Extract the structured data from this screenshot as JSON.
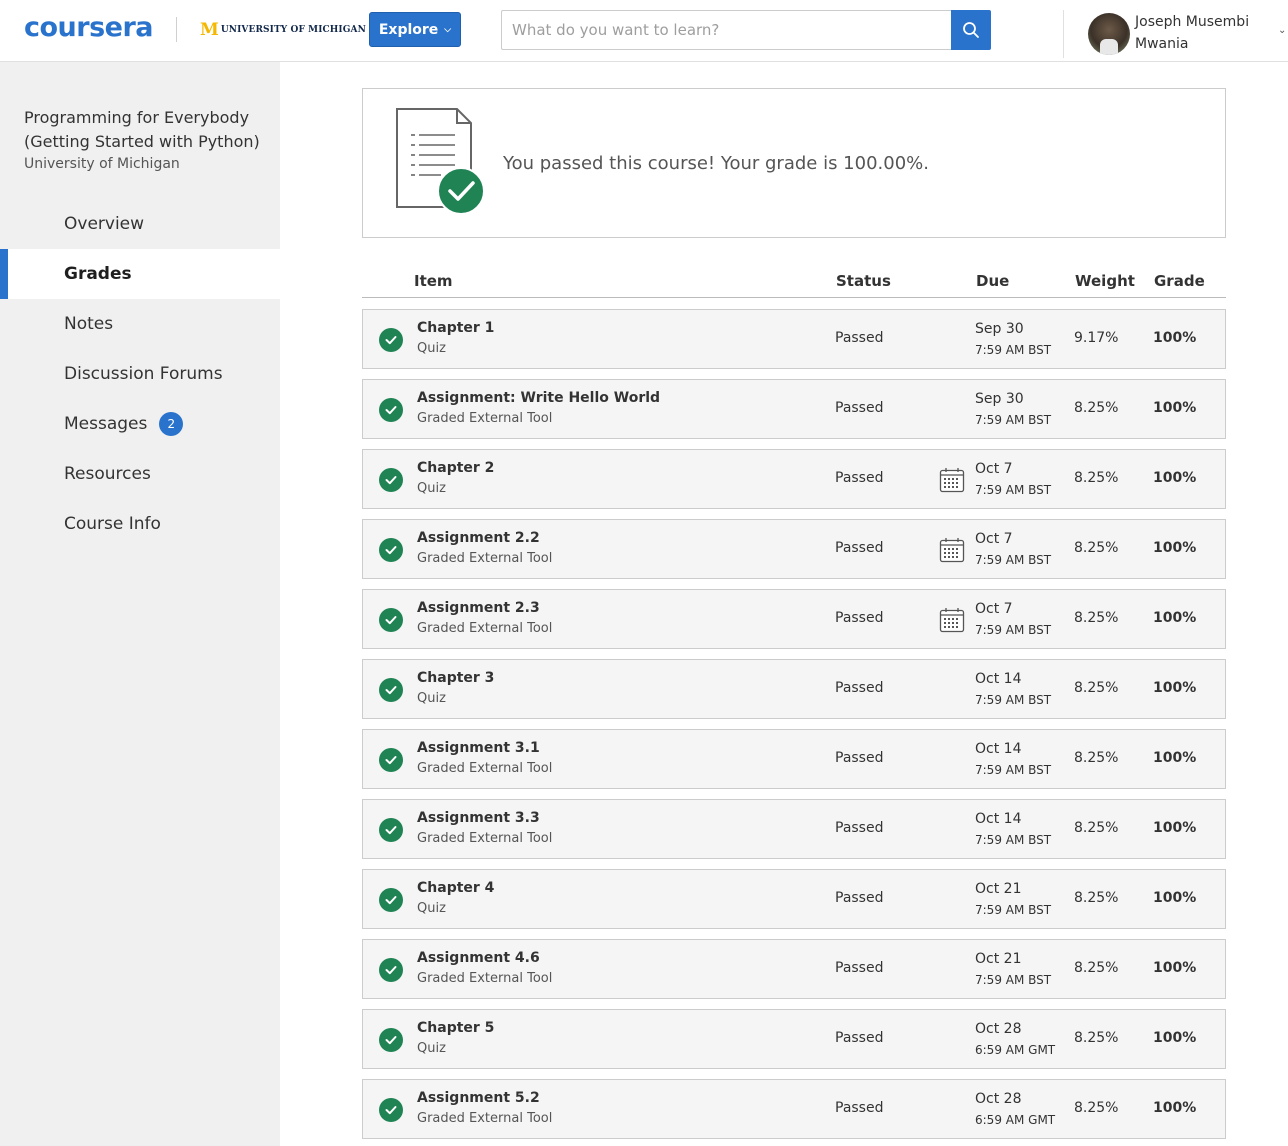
{
  "header": {
    "logo": "coursera",
    "partner_initial": "M",
    "partner_name": "UNIVERSITY OF MICHIGAN",
    "explore_label": "Explore",
    "search_placeholder": "What do you want to learn?",
    "user_name_line1": "Joseph Musembi",
    "user_name_line2": "Mwania"
  },
  "sidebar": {
    "course_title": "Programming for Everybody (Getting Started with Python)",
    "course_org": "University of Michigan",
    "items": [
      {
        "label": "Overview"
      },
      {
        "label": "Grades",
        "active": true
      },
      {
        "label": "Notes"
      },
      {
        "label": "Discussion Forums"
      },
      {
        "label": "Messages",
        "badge": "2"
      },
      {
        "label": "Resources"
      },
      {
        "label": "Course Info"
      }
    ]
  },
  "banner": {
    "text": "You passed this course! Your grade is 100.00%."
  },
  "table": {
    "headers": {
      "item": "Item",
      "status": "Status",
      "due": "Due",
      "weight": "Weight",
      "grade": "Grade"
    },
    "rows": [
      {
        "name": "Chapter 1",
        "type": "Quiz",
        "status": "Passed",
        "due_date": "Sep 30",
        "due_time": "7:59 AM BST",
        "calendar": false,
        "weight": "9.17%",
        "grade": "100%"
      },
      {
        "name": "Assignment: Write Hello World",
        "type": "Graded External Tool",
        "status": "Passed",
        "due_date": "Sep 30",
        "due_time": "7:59 AM BST",
        "calendar": false,
        "weight": "8.25%",
        "grade": "100%"
      },
      {
        "name": "Chapter 2",
        "type": "Quiz",
        "status": "Passed",
        "due_date": "Oct 7",
        "due_time": "7:59 AM BST",
        "calendar": true,
        "weight": "8.25%",
        "grade": "100%"
      },
      {
        "name": "Assignment 2.2",
        "type": "Graded External Tool",
        "status": "Passed",
        "due_date": "Oct 7",
        "due_time": "7:59 AM BST",
        "calendar": true,
        "weight": "8.25%",
        "grade": "100%"
      },
      {
        "name": "Assignment 2.3",
        "type": "Graded External Tool",
        "status": "Passed",
        "due_date": "Oct 7",
        "due_time": "7:59 AM BST",
        "calendar": true,
        "weight": "8.25%",
        "grade": "100%"
      },
      {
        "name": "Chapter 3",
        "type": "Quiz",
        "status": "Passed",
        "due_date": "Oct 14",
        "due_time": "7:59 AM BST",
        "calendar": false,
        "weight": "8.25%",
        "grade": "100%"
      },
      {
        "name": "Assignment 3.1",
        "type": "Graded External Tool",
        "status": "Passed",
        "due_date": "Oct 14",
        "due_time": "7:59 AM BST",
        "calendar": false,
        "weight": "8.25%",
        "grade": "100%"
      },
      {
        "name": "Assignment 3.3",
        "type": "Graded External Tool",
        "status": "Passed",
        "due_date": "Oct 14",
        "due_time": "7:59 AM BST",
        "calendar": false,
        "weight": "8.25%",
        "grade": "100%"
      },
      {
        "name": "Chapter 4",
        "type": "Quiz",
        "status": "Passed",
        "due_date": "Oct 21",
        "due_time": "7:59 AM BST",
        "calendar": false,
        "weight": "8.25%",
        "grade": "100%"
      },
      {
        "name": "Assignment 4.6",
        "type": "Graded External Tool",
        "status": "Passed",
        "due_date": "Oct 21",
        "due_time": "7:59 AM BST",
        "calendar": false,
        "weight": "8.25%",
        "grade": "100%"
      },
      {
        "name": "Chapter 5",
        "type": "Quiz",
        "status": "Passed",
        "due_date": "Oct 28",
        "due_time": "6:59 AM GMT",
        "calendar": false,
        "weight": "8.25%",
        "grade": "100%"
      },
      {
        "name": "Assignment 5.2",
        "type": "Graded External Tool",
        "status": "Passed",
        "due_date": "Oct 28",
        "due_time": "6:59 AM GMT",
        "calendar": false,
        "weight": "8.25%",
        "grade": "100%"
      }
    ]
  },
  "colors": {
    "brand": "#2a73cc",
    "success": "#1f8354"
  }
}
